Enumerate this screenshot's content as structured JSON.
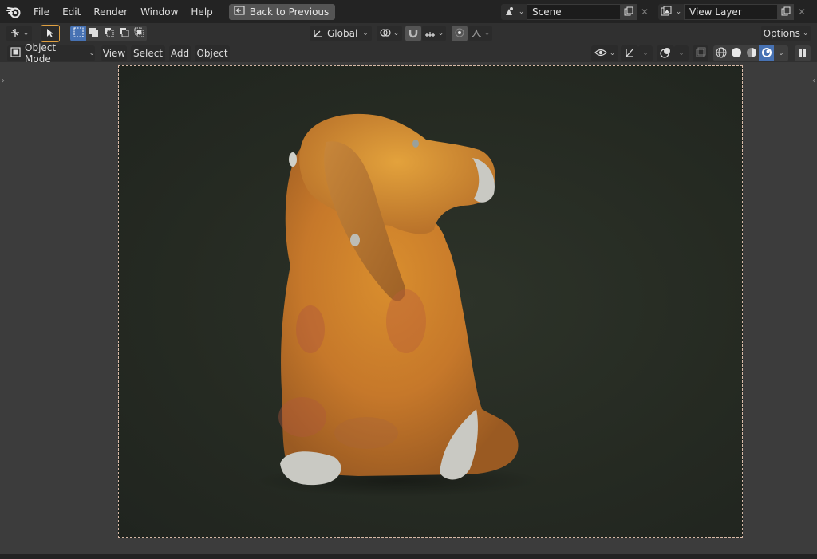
{
  "menu": {
    "items": [
      "File",
      "Edit",
      "Render",
      "Window",
      "Help"
    ],
    "back_to_previous": "Back to Previous"
  },
  "workspace": {
    "scene_name": "Scene",
    "view_layer_name": "View Layer"
  },
  "tool_settings": {
    "orientation": "Global",
    "options": "Options"
  },
  "viewport_header": {
    "mode": "Object Mode",
    "menus": [
      "View",
      "Select",
      "Add",
      "Object"
    ]
  },
  "viewport": {
    "object": "dog-figurine-scan",
    "shading": "rendered"
  },
  "colors": {
    "accent": "#4772b3",
    "frame_border": "#d7b9a7",
    "viewport_bg": "#3c3c3c"
  }
}
